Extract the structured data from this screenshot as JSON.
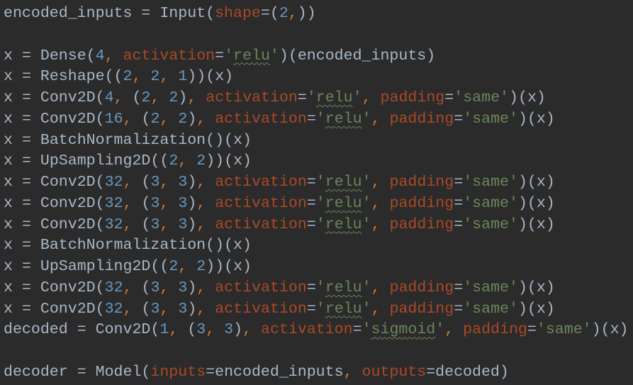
{
  "editor": {
    "language": "python",
    "colors": {
      "default": "#a9b7c6",
      "number": "#6897bb",
      "keyword_arg": "#aa4926",
      "string": "#6a8759",
      "punctuation": "#cc7832",
      "background": "#2b2b2b"
    },
    "spellcheck_flagged_words": [
      "relu",
      "sigmoid"
    ],
    "lines": [
      "encoded_inputs = Input(shape=(2,))",
      "",
      "x = Dense(4, activation='relu')(encoded_inputs)",
      "x = Reshape((2, 2, 1))(x)",
      "x = Conv2D(4, (2, 2), activation='relu', padding='same')(x)",
      "x = Conv2D(16, (2, 2), activation='relu', padding='same')(x)",
      "x = BatchNormalization()(x)",
      "x = UpSampling2D((2, 2))(x)",
      "x = Conv2D(32, (3, 3), activation='relu', padding='same')(x)",
      "x = Conv2D(32, (3, 3), activation='relu', padding='same')(x)",
      "x = Conv2D(32, (3, 3), activation='relu', padding='same')(x)",
      "x = BatchNormalization()(x)",
      "x = UpSampling2D((2, 2))(x)",
      "x = Conv2D(32, (3, 3), activation='relu', padding='same')(x)",
      "x = Conv2D(32, (3, 3), activation='relu', padding='same')(x)",
      "decoded = Conv2D(1, (3, 3), activation='sigmoid', padding='same')(x)",
      "",
      "decoder = Model(inputs=encoded_inputs, outputs=decoded)"
    ]
  }
}
